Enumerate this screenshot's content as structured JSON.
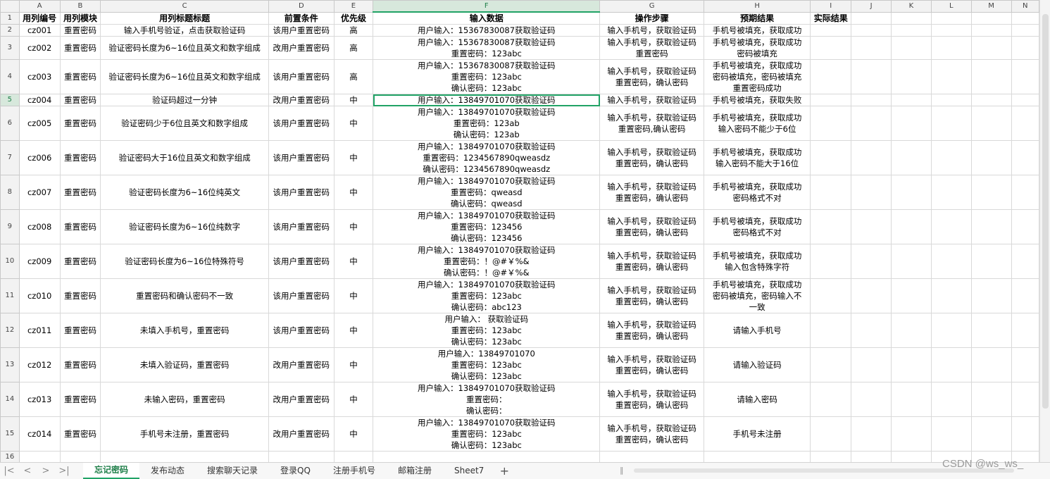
{
  "columns": [
    "A",
    "B",
    "C",
    "D",
    "E",
    "F",
    "G",
    "H",
    "I",
    "J",
    "K",
    "L",
    "M",
    "N"
  ],
  "selected_column": "F",
  "selected_row": 5,
  "headers": [
    "用列编号",
    "用列模块",
    "用列标题标题",
    "前置条件",
    "优先级",
    "输入数据",
    "操作步骤",
    "预期结果",
    "实际结果",
    "",
    "",
    "",
    "",
    ""
  ],
  "rows": [
    {
      "num": "2",
      "id": "cz001",
      "module": "重置密码",
      "title": "输入手机号验证，点击获取验证码",
      "pre": "该用户重置密码",
      "priority": "高",
      "input": [
        "用户输入：15367830087获取验证码"
      ],
      "steps": [
        "输入手机号，获取验证码"
      ],
      "expected": [
        "手机号被填充，获取成功"
      ]
    },
    {
      "num": "3",
      "id": "cz002",
      "module": "重置密码",
      "title": "验证密码长度为6~16位且英文和数字组成",
      "pre": "改用户重置密码",
      "priority": "高",
      "input": [
        "用户输入：15367830087获取验证码",
        "重置密码：123abc"
      ],
      "steps": [
        "输入手机号，获取验证码",
        "重置密码"
      ],
      "expected": [
        "手机号被填充，获取成功",
        "密码被填充"
      ]
    },
    {
      "num": "4",
      "id": "cz003",
      "module": "重置密码",
      "title": "验证密码长度为6~16位且英文和数字组成",
      "pre": "该用户重置密码",
      "priority": "高",
      "input": [
        "用户输入：15367830087获取验证码",
        "重置密码：123abc",
        "确认密码：123abc"
      ],
      "steps": [
        "输入手机号，获取验证码",
        "重置密码，确认密码"
      ],
      "expected": [
        "手机号被填充，获取成功",
        "密码被填充，密码被填充",
        "重置密码成功"
      ]
    },
    {
      "num": "5",
      "id": "cz004",
      "module": "重置密码",
      "title": "验证码超过一分钟",
      "pre": "改用户重置密码",
      "priority": "中",
      "input": [
        "用户输入：13849701070获取验证码"
      ],
      "steps": [
        "输入手机号，获取验证码"
      ],
      "expected": [
        "手机号被填充，获取失败"
      ]
    },
    {
      "num": "6",
      "id": "cz005",
      "module": "重置密码",
      "title": "验证密码少于6位且英文和数字组成",
      "pre": "该用户重置密码",
      "priority": "中",
      "input": [
        "用户输入：13849701070获取验证码",
        "重置密码：123ab",
        "确认密码：123ab"
      ],
      "steps": [
        "输入手机号，获取验证码",
        "重置密码,确认密码"
      ],
      "expected": [
        "手机号被填充，获取成功",
        "输入密码不能少于6位"
      ]
    },
    {
      "num": "7",
      "id": "cz006",
      "module": "重置密码",
      "title": "验证密码大于16位且英文和数字组成",
      "pre": "该用户重置密码",
      "priority": "中",
      "input": [
        "用户输入：13849701070获取验证码",
        "重置密码：1234567890qweasdz",
        "确认密码：1234567890qweasdz"
      ],
      "steps": [
        "输入手机号，获取验证码",
        "重置密码，确认密码"
      ],
      "expected": [
        "手机号被填充，获取成功",
        "输入密码不能大于16位"
      ]
    },
    {
      "num": "8",
      "id": "cz007",
      "module": "重置密码",
      "title": "验证密码长度为6~16位纯英文",
      "pre": "该用户重置密码",
      "priority": "中",
      "input": [
        "用户输入：13849701070获取验证码",
        "重置密码：qweasd",
        "确认密码：qweasd"
      ],
      "steps": [
        "输入手机号，获取验证码",
        "重置密码，确认密码"
      ],
      "expected": [
        "手机号被填充，获取成功",
        "密码格式不对"
      ]
    },
    {
      "num": "9",
      "id": "cz008",
      "module": "重置密码",
      "title": "验证密码长度为6~16位纯数字",
      "pre": "该用户重置密码",
      "priority": "中",
      "input": [
        "用户输入：13849701070获取验证码",
        "重置密码：123456",
        "确认密码：123456"
      ],
      "steps": [
        "输入手机号，获取验证码",
        "重置密码，确认密码"
      ],
      "expected": [
        "手机号被填充，获取成功",
        "密码格式不对"
      ]
    },
    {
      "num": "10",
      "id": "cz009",
      "module": "重置密码",
      "title": "验证密码长度为6~16位特殊符号",
      "pre": "该用户重置密码",
      "priority": "中",
      "input": [
        "用户输入：13849701070获取验证码",
        "重置密码：！@#￥%&",
        "确认密码：！@#￥%&"
      ],
      "steps": [
        "输入手机号，获取验证码",
        "重置密码，确认密码"
      ],
      "expected": [
        "手机号被填充，获取成功",
        "输入包含特殊字符"
      ]
    },
    {
      "num": "11",
      "id": "cz010",
      "module": "重置密码",
      "title": "重置密码和确认密码不一致",
      "pre": "该用户重置密码",
      "priority": "中",
      "input": [
        "用户输入：13849701070获取验证码",
        "重置密码：123abc",
        "确认密码：abc123"
      ],
      "steps": [
        "输入手机号，获取验证码",
        "重置密码，确认密码"
      ],
      "expected": [
        "手机号被填充，获取成功",
        "密码被填充，密码输入不",
        "一致"
      ]
    },
    {
      "num": "12",
      "id": "cz011",
      "module": "重置密码",
      "title": "未填入手机号，重置密码",
      "pre": "该用户重置密码",
      "priority": "中",
      "input": [
        "用户输入：           获取验证码",
        "重置密码：123abc",
        "确认密码：123abc"
      ],
      "steps": [
        "输入手机号，获取验证码",
        "重置密码，确认密码"
      ],
      "expected": [
        "请输入手机号"
      ]
    },
    {
      "num": "13",
      "id": "cz012",
      "module": "重置密码",
      "title": "未填入验证码，重置密码",
      "pre": "改用户重置密码",
      "priority": "中",
      "input": [
        "用户输入：13849701070",
        "重置密码：123abc",
        "确认密码：123abc"
      ],
      "steps": [
        "输入手机号，获取验证码",
        "重置密码，确认密码"
      ],
      "expected": [
        "请输入验证码"
      ]
    },
    {
      "num": "14",
      "id": "cz013",
      "module": "重置密码",
      "title": "未输入密码，重置密码",
      "pre": "改用户重置密码",
      "priority": "中",
      "input": [
        "用户输入：13849701070获取验证码",
        "重置密码：",
        "确认密码："
      ],
      "steps": [
        "输入手机号，获取验证码",
        "重置密码，确认密码"
      ],
      "expected": [
        "请输入密码"
      ]
    },
    {
      "num": "15",
      "id": "cz014",
      "module": "重置密码",
      "title": "手机号未注册，重置密码",
      "pre": "改用户重置密码",
      "priority": "中",
      "input": [
        "用户输入：13849701070获取验证码",
        "重置密码：123abc",
        "确认密码：123abc"
      ],
      "steps": [
        "输入手机号，获取验证码",
        "重置密码，确认密码"
      ],
      "expected": [
        "手机号未注册"
      ]
    }
  ],
  "last_row_num": "16",
  "tabs": [
    "忘记密码",
    "发布动态",
    "搜索聊天记录",
    "登录QQ",
    "注册手机号",
    "邮箱注册",
    "Sheet7"
  ],
  "active_tab": 0,
  "nav_glyphs": [
    "|<",
    "<",
    ">",
    ">|"
  ],
  "add_tab_glyph": "+",
  "watermark": "CSDN @ws_ws_",
  "colors": {
    "accent": "#21a366",
    "grid": "#d9d9d9",
    "header_bg": "#f2f2f2"
  }
}
